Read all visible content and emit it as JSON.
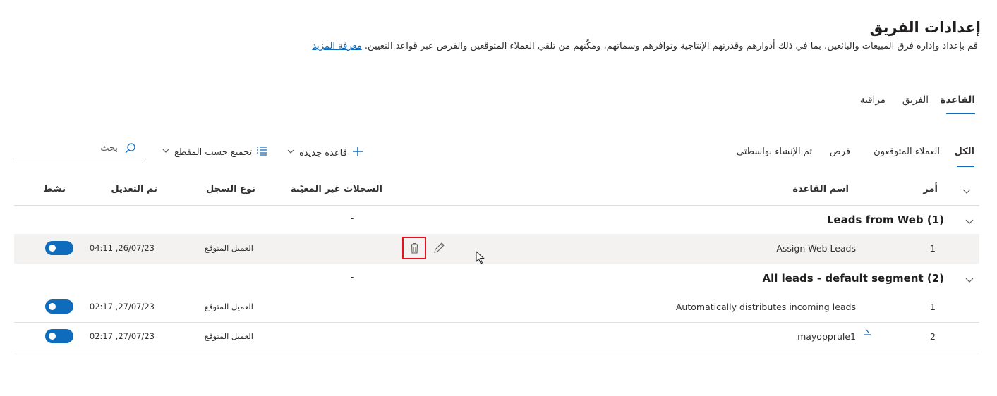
{
  "page": {
    "title": "إعدادات الفريق",
    "description": "قم بإعداد وإدارة فرق المبيعات والبائعين، بما في ذلك أدوارهم وقدرتهم الإنتاجية وتوافرهم وسماتهم، ومكّنهم من تلقي العملاء المتوقعين والفرص عبر قواعد التعيين.",
    "learn_more": "معرفة المزيد"
  },
  "tabs": [
    {
      "label": "القاعدة",
      "active": true
    },
    {
      "label": "الفريق",
      "active": false
    },
    {
      "label": "مراقبة",
      "active": false
    }
  ],
  "filters": [
    {
      "label": "الكل",
      "active": true
    },
    {
      "label": "العملاء المتوقعون",
      "active": false
    },
    {
      "label": "فرص",
      "active": false
    },
    {
      "label": "تم الإنشاء بواسطتي",
      "active": false
    }
  ],
  "commands": {
    "new_rule": "قاعدة جديدة",
    "group_by": "تجميع حسب المقطع",
    "search_placeholder": "بحث"
  },
  "columns": {
    "order": "أمر",
    "rule_name": "اسم القاعدة",
    "unassigned": "السجلات غير المعيّنة",
    "record_type": "نوع السجل",
    "modified": "تم التعديل",
    "active": "نشط"
  },
  "groups": [
    {
      "title": "Leads from Web (1)",
      "unassigned": "-",
      "rows": [
        {
          "order": "1",
          "name": "Assign Web Leads",
          "record_type": "العميل المتوقع",
          "modified": "04:11 ,26/07/23",
          "active": true
        }
      ]
    },
    {
      "title": "All leads - default segment (2)",
      "unassigned": "-",
      "rows": [
        {
          "order": "1",
          "name": "Automatically distributes incoming leads",
          "record_type": "العميل المتوقع",
          "modified": "02:17 ,27/07/23",
          "active": true
        },
        {
          "order": "2",
          "name": "mayopprule1",
          "record_type": "العميل المتوقع",
          "modified": "02:17 ,27/07/23",
          "active": true
        }
      ]
    }
  ],
  "colors": {
    "accent": "#0f6cbd",
    "highlight_border": "#e81123",
    "row_selected": "#f3f2f1"
  }
}
